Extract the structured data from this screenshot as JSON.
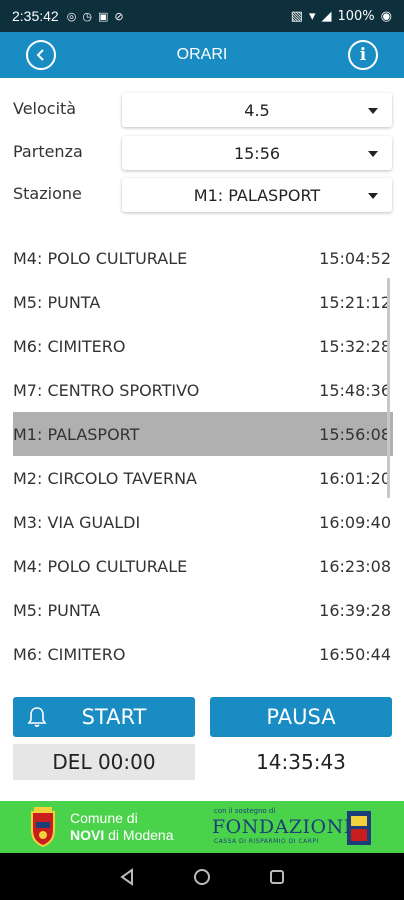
{
  "status_bar": {
    "time": "2:35:42",
    "battery": "100%"
  },
  "app_bar": {
    "title": "ORARI"
  },
  "form": {
    "speed": {
      "label": "Velocità",
      "value": "4.5"
    },
    "departure": {
      "label": "Partenza",
      "value": "15:56"
    },
    "station": {
      "label": "Stazione",
      "value": "M1: PALASPORT"
    }
  },
  "schedule": [
    {
      "station": "M4: POLO CULTURALE",
      "time": "15:04:52",
      "selected": false
    },
    {
      "station": "M5: PUNTA",
      "time": "15:21:12",
      "selected": false
    },
    {
      "station": "M6: CIMITERO",
      "time": "15:32:28",
      "selected": false
    },
    {
      "station": "M7: CENTRO SPORTIVO",
      "time": "15:48:36",
      "selected": false
    },
    {
      "station": "M1: PALASPORT",
      "time": "15:56:08",
      "selected": true
    },
    {
      "station": "M2: CIRCOLO TAVERNA",
      "time": "16:01:20",
      "selected": false
    },
    {
      "station": "M3: VIA GUALDI",
      "time": "16:09:40",
      "selected": false
    },
    {
      "station": "M4: POLO CULTURALE",
      "time": "16:23:08",
      "selected": false
    },
    {
      "station": "M5: PUNTA",
      "time": "16:39:28",
      "selected": false
    },
    {
      "station": "M6: CIMITERO",
      "time": "16:50:44",
      "selected": false
    }
  ],
  "controls": {
    "start_label": "START",
    "pause_label": "PAUSA",
    "elapsed": "DEL 00:00",
    "clock": "14:35:43"
  },
  "footer": {
    "comune_line1": "Comune di",
    "comune_bold": "NOVI",
    "comune_rest": " di Modena",
    "fondazione_small": "con il sostegno di",
    "fondazione_name": "FONDAZIONE",
    "fondazione_sub": "CASSA DI RISPARMIO DI CARPI"
  },
  "colors": {
    "status_bar": "#0e2f3c",
    "accent": "#1a8cc4",
    "selected_row": "#b0b0b0",
    "footer": "#4ad34a"
  }
}
